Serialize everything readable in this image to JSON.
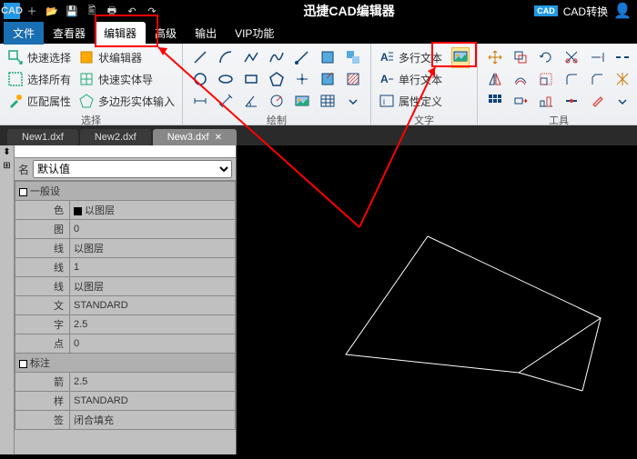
{
  "titlebar": {
    "app_badge": "CAD",
    "title": "迅捷CAD编辑器",
    "cad_convert": "CAD转换"
  },
  "menubar": {
    "file": "文件",
    "tabs": [
      "查看器",
      "编辑器",
      "高级",
      "输出",
      "VIP功能"
    ],
    "active": "编辑器"
  },
  "ribbon": {
    "select": {
      "label": "选择",
      "items": [
        "快速选择",
        "选择所有",
        "匹配属性"
      ],
      "col2": [
        "状编辑器",
        "快速实体导",
        "多边形实体输入"
      ]
    },
    "draw": {
      "label": "绘制"
    },
    "text": {
      "label": "文字",
      "items": [
        "多行文本",
        "单行文本",
        "属性定义"
      ]
    },
    "tools": {
      "label": "工具"
    }
  },
  "doctabs": {
    "tabs": [
      "New1.dxf",
      "New2.dxf",
      "New3.dxf"
    ],
    "active": 2
  },
  "panel": {
    "name_label": "名",
    "default_value": "默认值",
    "groups": [
      {
        "title": "一般设",
        "rows": [
          {
            "k": "色",
            "v": "以图层",
            "swatch": "m"
          },
          {
            "k": "图",
            "v": "0"
          },
          {
            "k": "线",
            "v": "以图层"
          },
          {
            "k": "线",
            "v": "1"
          },
          {
            "k": "线",
            "v": "以图层"
          },
          {
            "k": "文",
            "v": "STANDARD"
          },
          {
            "k": "字",
            "v": "2.5"
          },
          {
            "k": "点",
            "v": "0"
          }
        ]
      },
      {
        "title": "标注",
        "rows": [
          {
            "k": "箭",
            "v": "2.5"
          },
          {
            "k": "样",
            "v": "STANDARD"
          },
          {
            "k": "签",
            "v": "闭合填充"
          }
        ]
      }
    ]
  }
}
